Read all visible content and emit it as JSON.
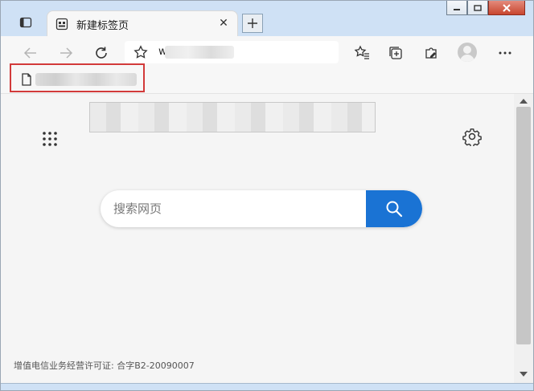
{
  "tab": {
    "title": "新建标签页",
    "close_label": "✕"
  },
  "address": {
    "url_prefix": "w"
  },
  "search": {
    "placeholder": "搜索网页"
  },
  "footer": {
    "license": "增值电信业务经营许可证: 合字B2-20090007"
  },
  "icons": {
    "tab_actions": "tab-actions-icon",
    "new_tab": "plus-icon",
    "back": "back-arrow-icon",
    "forward": "forward-arrow-icon",
    "refresh": "refresh-icon",
    "favorite": "star-icon",
    "favorites_list": "favorites-list-icon",
    "collections": "collections-icon",
    "extensions": "extensions-icon",
    "profile": "avatar-icon",
    "menu": "more-icon",
    "bookmark": "document-icon",
    "apps": "apps-grid-icon",
    "settings": "gear-icon",
    "search": "search-icon"
  },
  "colors": {
    "accent": "#1a73d4",
    "highlight_border": "#d23a3a",
    "titlebar": "#cfe1f5"
  }
}
